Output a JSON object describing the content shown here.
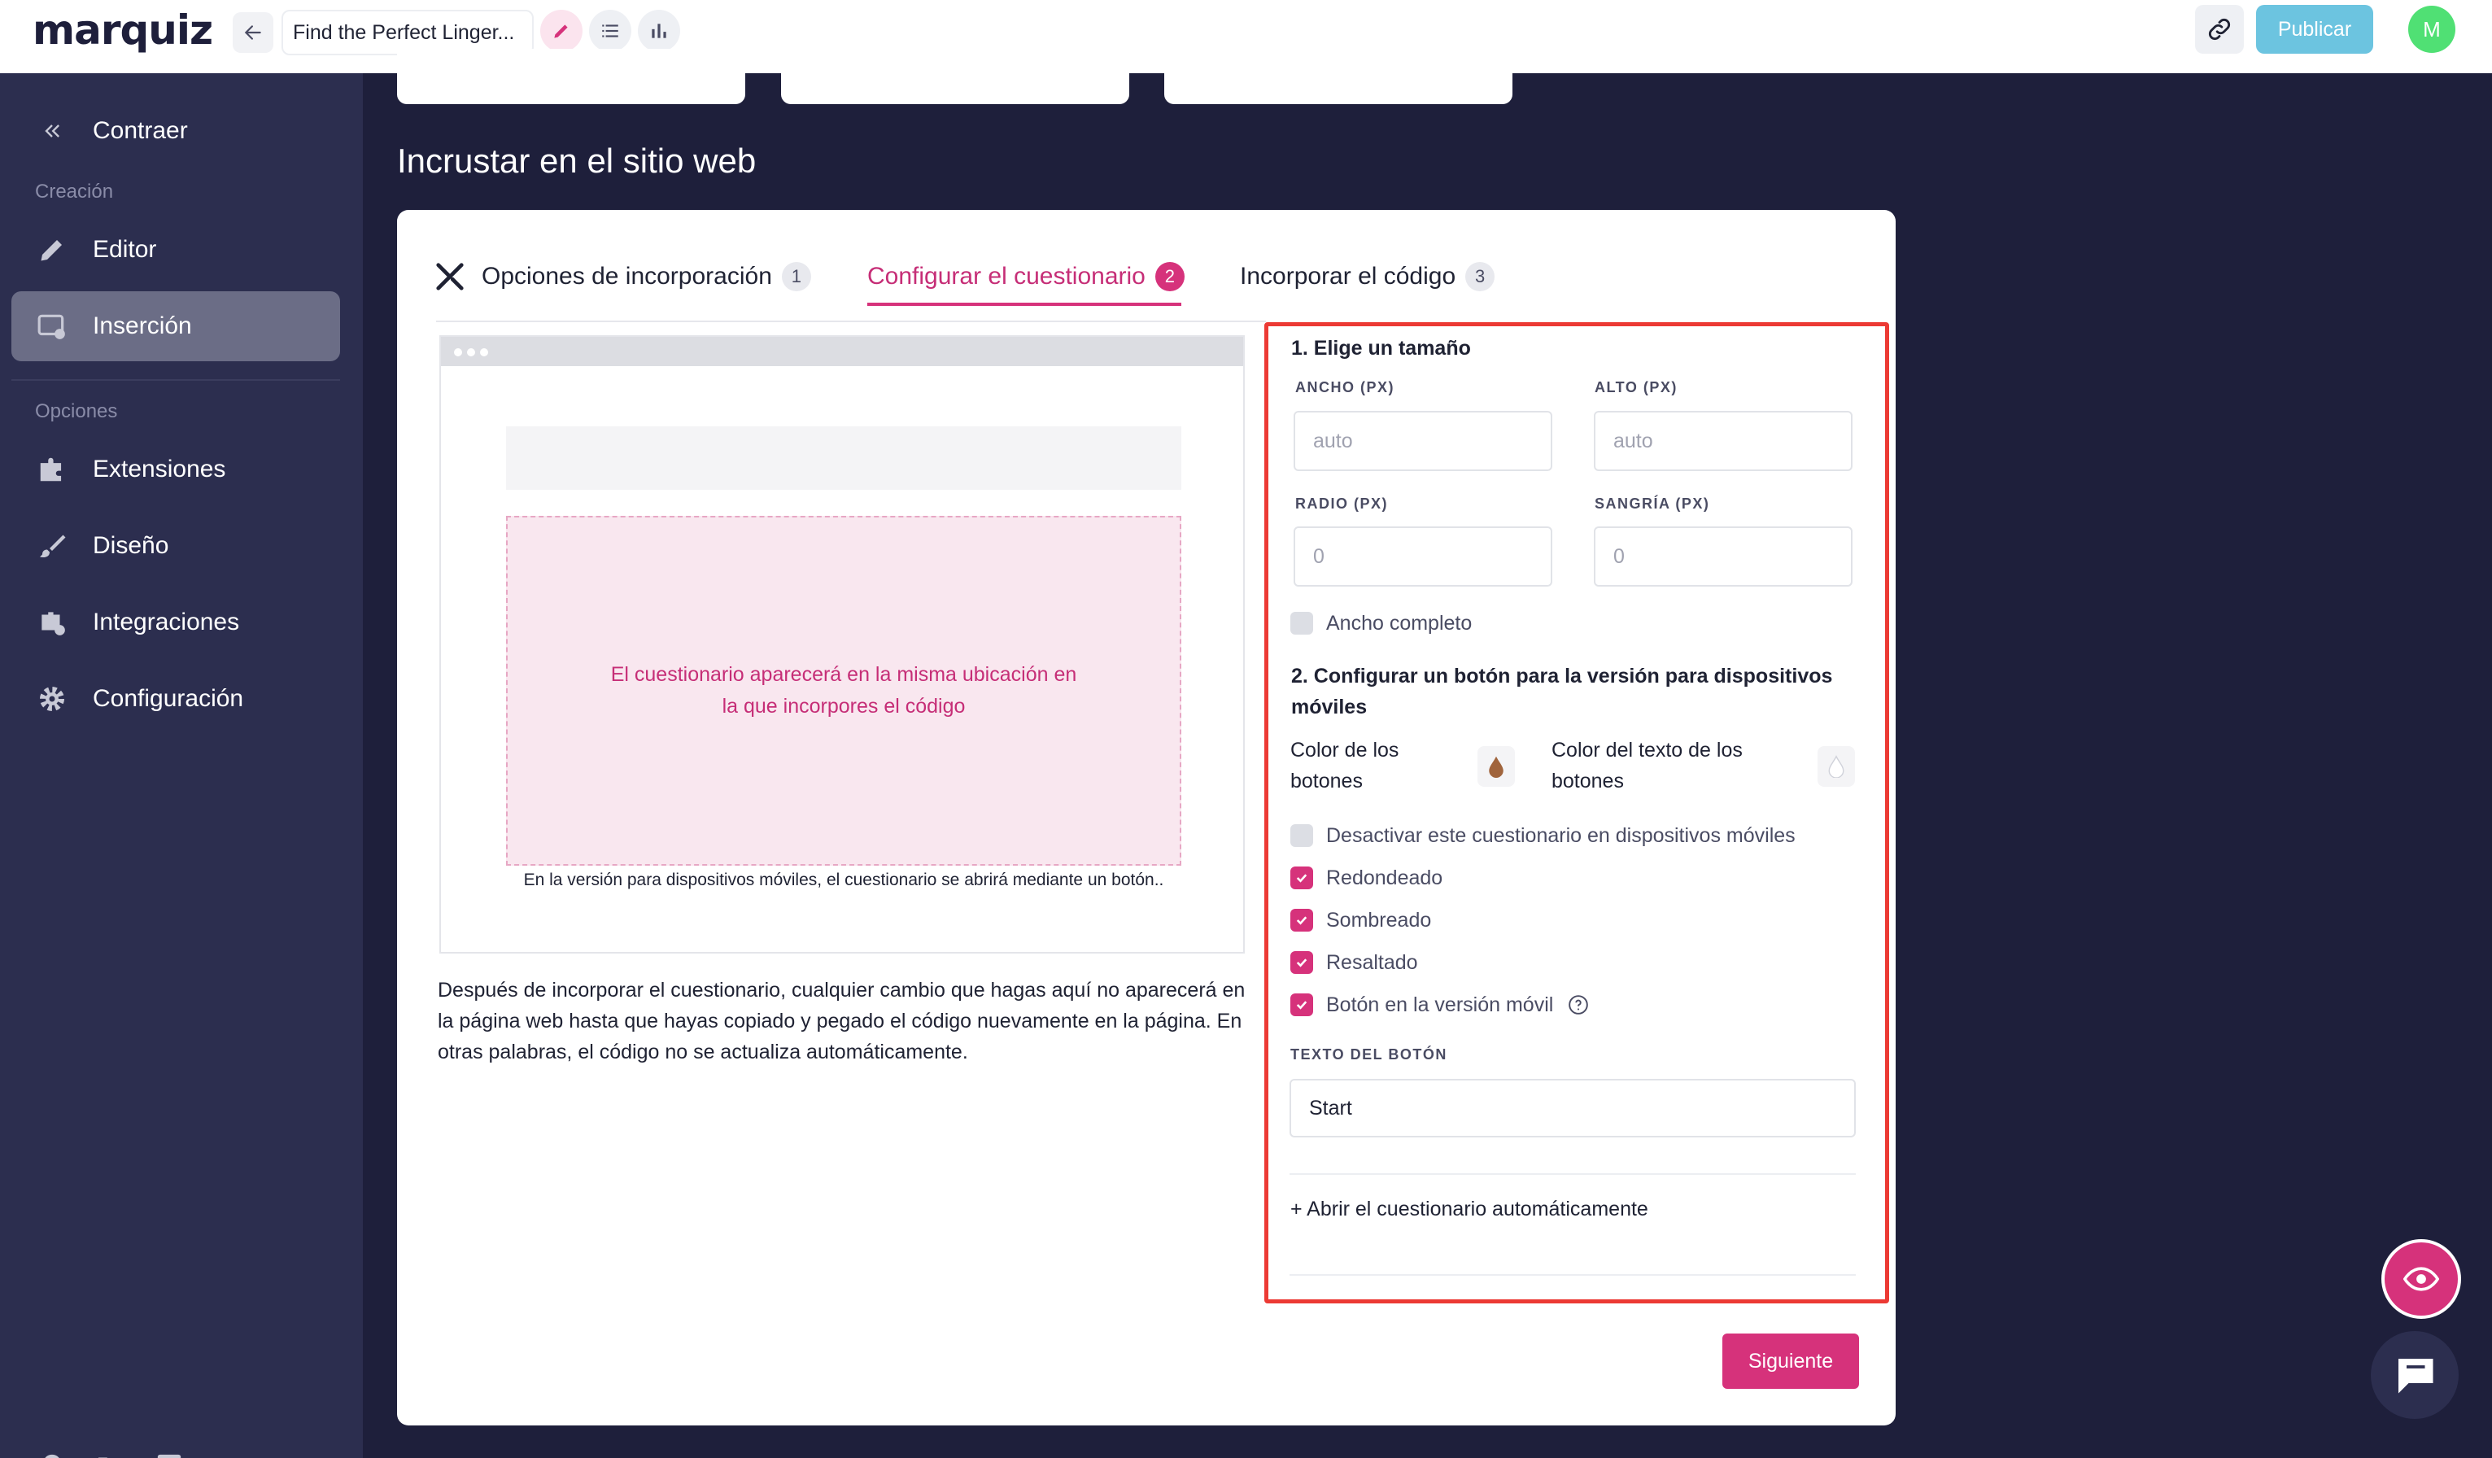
{
  "app": {
    "logo": "marquiz",
    "quiz_title": "Find the Perfect Linger...",
    "publish_label": "Publicar",
    "avatar_initial": "M"
  },
  "sidebar": {
    "collapse_label": "Contraer",
    "section_creation": "Creación",
    "section_options": "Opciones",
    "items": [
      {
        "label": "Editor",
        "icon": "pencil-icon"
      },
      {
        "label": "Inserción",
        "icon": "embed-icon",
        "active": true
      },
      {
        "label": "Extensiones",
        "icon": "puzzle-icon"
      },
      {
        "label": "Diseño",
        "icon": "brush-icon"
      },
      {
        "label": "Integraciones",
        "icon": "integrations-icon"
      },
      {
        "label": "Configuración",
        "icon": "gear-icon"
      }
    ]
  },
  "main": {
    "heading": "Incrustar en el sitio web",
    "tabs": [
      {
        "label": "Opciones de incorporación",
        "badge": "1"
      },
      {
        "label": "Configurar el cuestionario",
        "badge": "2",
        "active": true
      },
      {
        "label": "Incorporar el código",
        "badge": "3"
      }
    ],
    "preview": {
      "quiz_text": "El cuestionario aparecerá en la misma ubicación en la que incorpores el código",
      "mobile_note": "En la versión para dispositivos móviles, el cuestionario se abrirá mediante un botón.."
    },
    "after_note": "Después de incorporar el cuestionario, cualquier cambio que hagas aquí no aparecerá en la página web hasta que hayas copiado y pegado el código nuevamente en la página. En otras palabras, el código no se actualiza automáticamente.",
    "settings": {
      "size_title": "1. Elige un tamaño",
      "width_label": "ANCHO (PX)",
      "width_placeholder": "auto",
      "height_label": "ALTO (PX)",
      "height_placeholder": "auto",
      "radius_label": "RADIO (PX)",
      "radius_placeholder": "0",
      "indent_label": "SANGRÍA (PX)",
      "indent_placeholder": "0",
      "full_width_label": "Ancho completo",
      "mobile_title": "2. Configurar un botón para la versión para dispositivos móviles",
      "button_color_label": "Color de los botones",
      "button_text_color_label": "Color del texto de los botones",
      "button_color": "#a0643c",
      "checks": [
        {
          "label": "Desactivar este cuestionario en dispositivos móviles",
          "checked": false
        },
        {
          "label": "Redondeado",
          "checked": true
        },
        {
          "label": "Sombreado",
          "checked": true
        },
        {
          "label": "Resaltado",
          "checked": true
        },
        {
          "label": "Botón en la versión móvil",
          "checked": true
        }
      ],
      "button_text_label": "TEXTO DEL BOTÓN",
      "button_text_value": "Start",
      "auto_open_label": "+ Abrir el cuestionario automáticamente"
    },
    "next_label": "Siguiente"
  },
  "colors": {
    "accent": "#d6327b",
    "sidebar": "#2c2e4f",
    "background": "#1e1f3b",
    "publish": "#6cc4e0",
    "highlight": "#ec3a34"
  }
}
